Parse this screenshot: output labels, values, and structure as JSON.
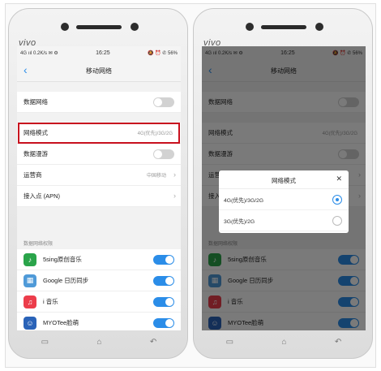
{
  "phone": {
    "brand": "vivo",
    "status": {
      "left": "4G ııl 0.2K/s ✉ ⚙",
      "time": "16:25",
      "right": "🔕 ⏰ ✆ 56%"
    }
  },
  "screen": {
    "title": "移动网络",
    "back_icon": "‹",
    "rows": {
      "data_network": "数据网络",
      "network_mode": "网络模式",
      "network_mode_value": "4G(优先)/3G/2G",
      "data_roaming": "数据漫游",
      "carrier": "运营商",
      "carrier_value": "中国移动",
      "apn": "接入点 (APN)"
    },
    "section_title": "数据网络权限",
    "apps": [
      {
        "name": "5sing原创音乐",
        "icon": "5sing-icon",
        "color": "#2aa44a"
      },
      {
        "name": "Google 日历同步",
        "icon": "google-calendar-sync-icon",
        "color": "#4f9ad8"
      },
      {
        "name": "i 音乐",
        "icon": "music-icon",
        "color": "#ec3d4b"
      },
      {
        "name": "MYOTee脸萌",
        "icon": "myotee-icon",
        "color": "#2a63b8"
      }
    ]
  },
  "dialog": {
    "title": "网络模式",
    "close": "✕",
    "options": [
      "4G(优先)/3G/2G",
      "3G(优先)/2G"
    ],
    "selected_index": 0
  },
  "nav": {
    "menu": "▭",
    "home": "⌂",
    "back": "↶"
  }
}
